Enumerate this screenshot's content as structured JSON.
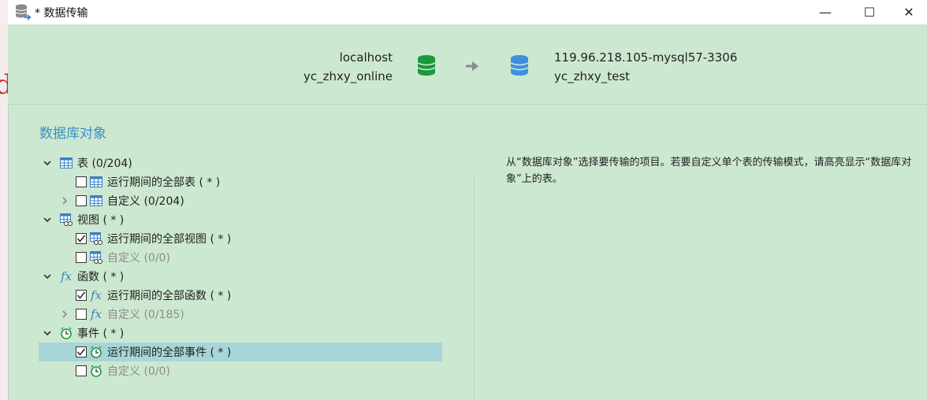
{
  "window": {
    "title": "* 数据传输"
  },
  "source": {
    "host": "localhost",
    "database": "yc_zhxy_online",
    "color": "#1a9a3c"
  },
  "target": {
    "host": "119.96.218.105-mysql57-3306",
    "database": "yc_zhxy_test",
    "color": "#3d8fe0"
  },
  "section_title": "数据库对象",
  "tree": {
    "tables": {
      "label": "表 (0/204)",
      "all": "运行期间的全部表 ( * )",
      "custom": "自定义 (0/204)"
    },
    "views": {
      "label": "视图 ( * )",
      "all": "运行期间的全部视图 ( * )",
      "custom": "自定义 (0/0)"
    },
    "functions": {
      "label": "函数 ( * )",
      "all": "运行期间的全部函数 ( * )",
      "custom": "自定义 (0/185)"
    },
    "events": {
      "label": "事件 ( * )",
      "all": "运行期间的全部事件 ( * )",
      "custom": "自定义 (0/0)"
    }
  },
  "icon_glyphs": {
    "function": "fx"
  },
  "description": "从“数据库对象”选择要传输的项目。若要自定义单个表的传输模式，请高亮显示“数据库对象”上的表。",
  "window_controls": {
    "minimize": "—",
    "maximize": "☐",
    "close": "✕"
  },
  "checked": {
    "tables_all": false,
    "tables_custom": false,
    "views_all": true,
    "views_custom": false,
    "functions_all": true,
    "functions_custom": false,
    "events_all": true,
    "events_custom": false
  }
}
